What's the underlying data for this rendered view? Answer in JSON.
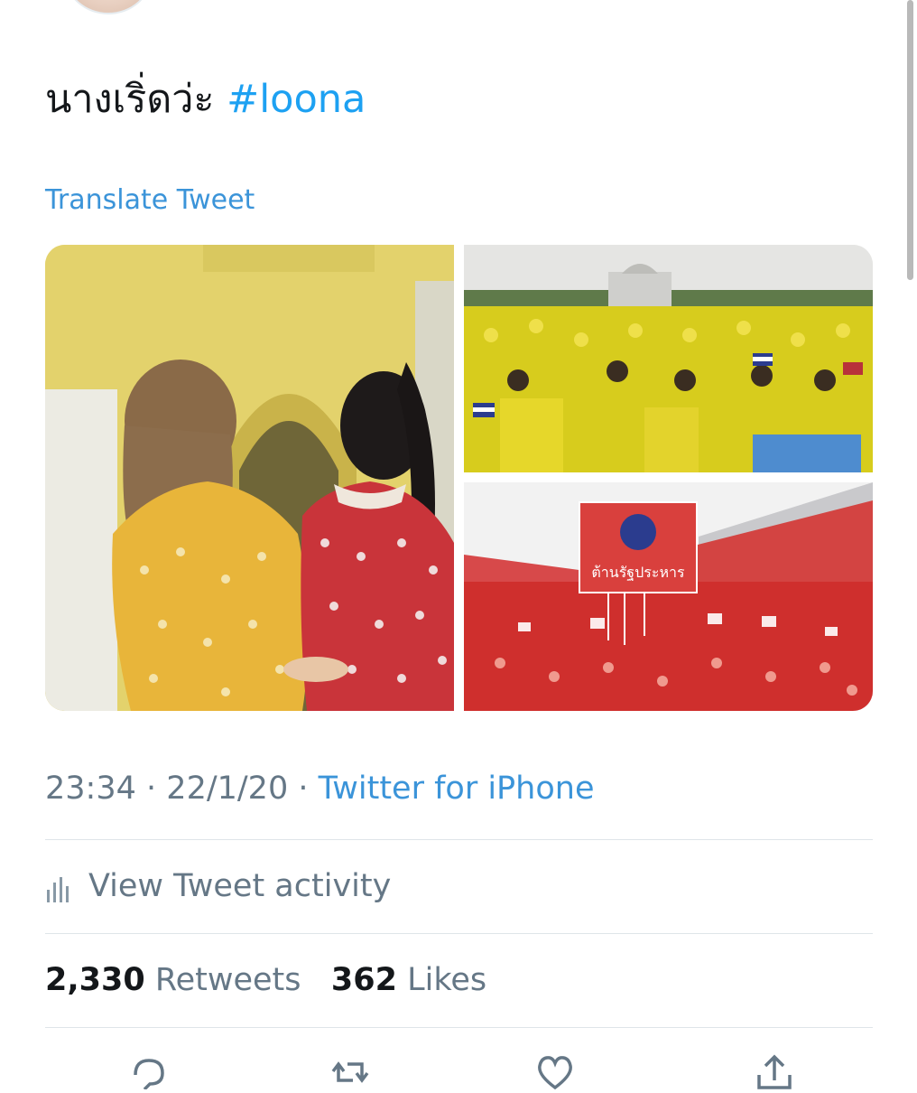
{
  "tweet": {
    "text": "นางเริ่ดว่ะ",
    "hashtag": "#loona",
    "translate_label": "Translate Tweet",
    "time": "23:34",
    "date": "22/1/20",
    "separator": "·",
    "source": "Twitter for iPhone"
  },
  "activity": {
    "label": "View Tweet activity",
    "icon": "bar-chart-icon"
  },
  "stats": {
    "retweets_count": "2,330",
    "retweets_label": "Retweets",
    "likes_count": "362",
    "likes_label": "Likes"
  },
  "media": {
    "banner_text": "ต้านรัฐประหาร"
  },
  "actions": {
    "reply_icon": "reply-icon",
    "retweet_icon": "retweet-icon",
    "like_icon": "heart-icon",
    "share_icon": "share-icon"
  },
  "colors": {
    "link": "#3b94d9",
    "secondary_text": "#657786",
    "primary_text": "#14171a",
    "divider": "#dfe5e9"
  }
}
